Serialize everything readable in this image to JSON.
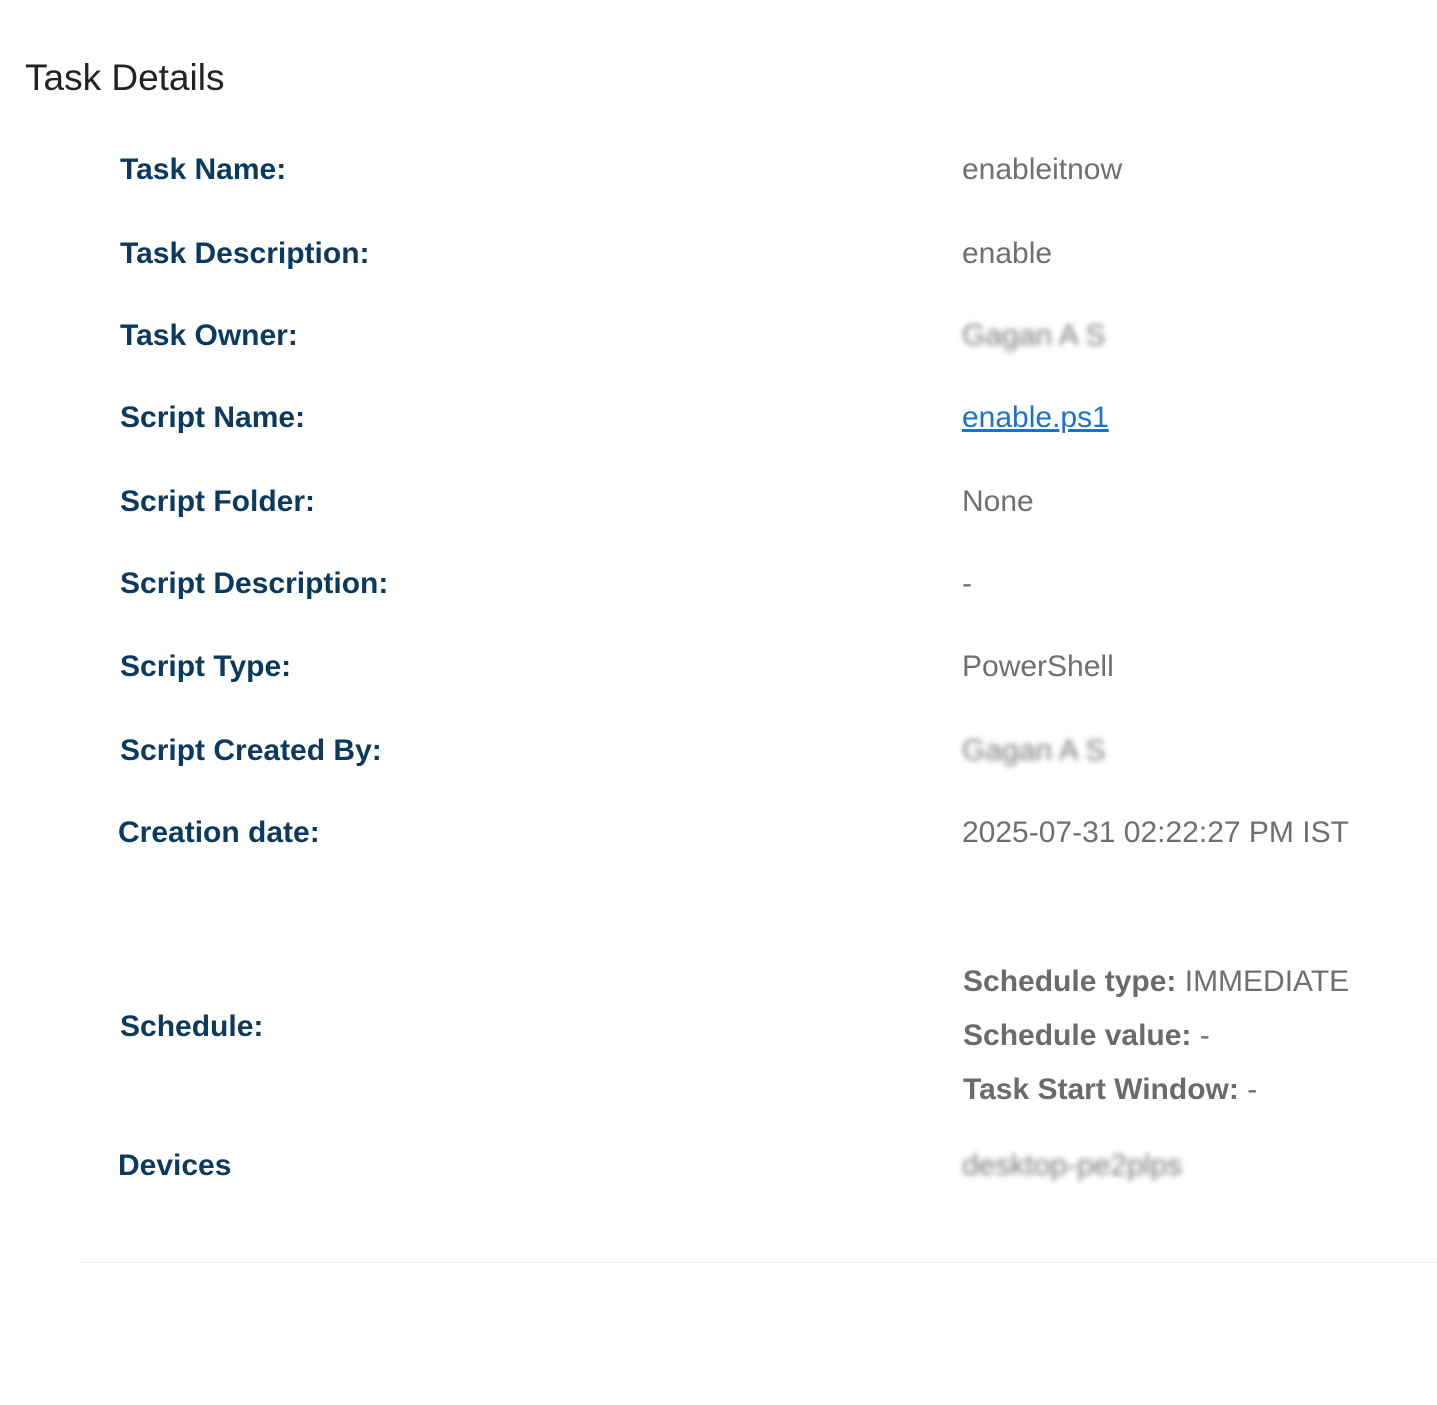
{
  "page_title": "Task Details",
  "rows": {
    "task_name": {
      "label": "Task Name:",
      "value": "enableitnow"
    },
    "task_description": {
      "label": "Task Description:",
      "value": "enable"
    },
    "task_owner": {
      "label": "Task Owner:",
      "value": "Gagan A S"
    },
    "script_name": {
      "label": "Script Name:",
      "value": "enable.ps1"
    },
    "script_folder": {
      "label": "Script Folder:",
      "value": "None"
    },
    "script_description": {
      "label": "Script Description:",
      "value": "-"
    },
    "script_type": {
      "label": "Script Type:",
      "value": "PowerShell"
    },
    "script_created_by": {
      "label": "Script Created By:",
      "value": "Gagan A S"
    },
    "creation_date": {
      "label": "Creation date:",
      "value": "2025-07-31 02:22:27 PM IST"
    }
  },
  "schedule": {
    "label": "Schedule:",
    "type_key": "Schedule type:",
    "type_value": "IMMEDIATE",
    "value_key": "Schedule value:",
    "value_value": "-",
    "window_key": "Task Start Window:",
    "window_value": "-"
  },
  "devices": {
    "label": "Devices",
    "value": "desktop-pe2plps"
  },
  "colors": {
    "label": "#0c3a5e",
    "value": "#6f6f6f",
    "link": "#1a73c8"
  }
}
